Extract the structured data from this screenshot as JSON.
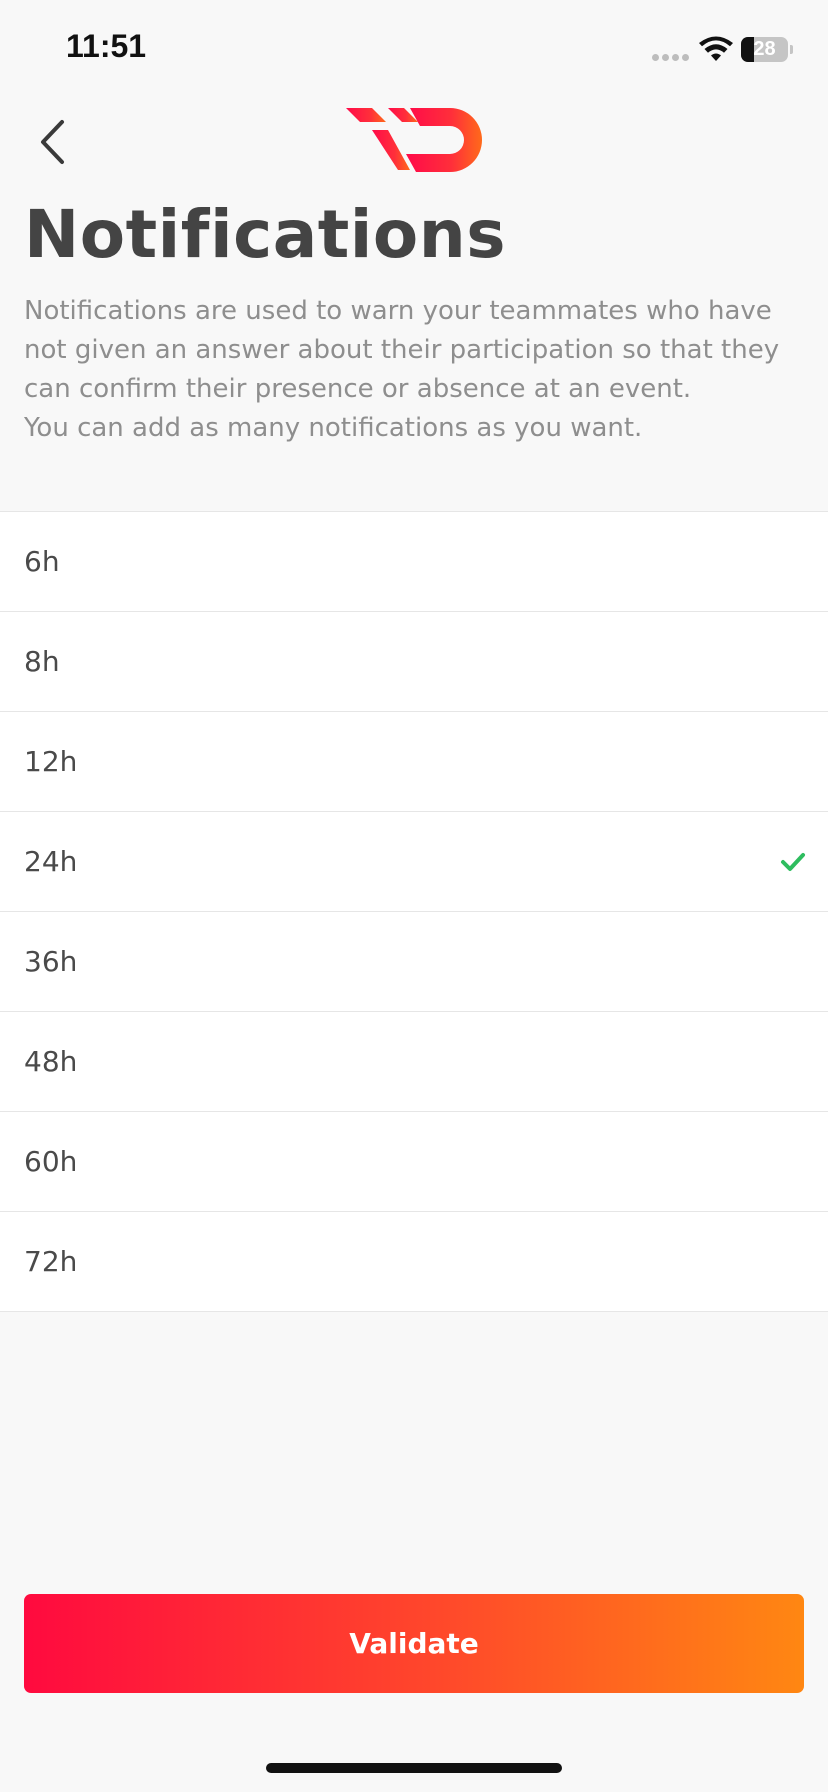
{
  "status_bar": {
    "time": "11:51",
    "battery_level": "28",
    "battery_fraction": 0.28
  },
  "nav": {
    "back_icon": "chevron-left-icon",
    "logo_icon": "app-logo"
  },
  "page": {
    "title": "Notifications",
    "description_line1": "Notifications are used to warn your teammates who have not given an answer about their participation so that they can confirm their presence or absence at an event.",
    "description_line2": "You can add as many notifications as you want."
  },
  "options": [
    {
      "label": "6h",
      "selected": false
    },
    {
      "label": "8h",
      "selected": false
    },
    {
      "label": "12h",
      "selected": false
    },
    {
      "label": "24h",
      "selected": true
    },
    {
      "label": "36h",
      "selected": false
    },
    {
      "label": "48h",
      "selected": false
    },
    {
      "label": "60h",
      "selected": false
    },
    {
      "label": "72h",
      "selected": false
    }
  ],
  "footer": {
    "validate_label": "Validate"
  },
  "colors": {
    "check": "#2ebd5f",
    "gradient_start": "#ff0a3f",
    "gradient_end": "#ff8712",
    "title": "#444444",
    "description": "#8e8e8e"
  }
}
